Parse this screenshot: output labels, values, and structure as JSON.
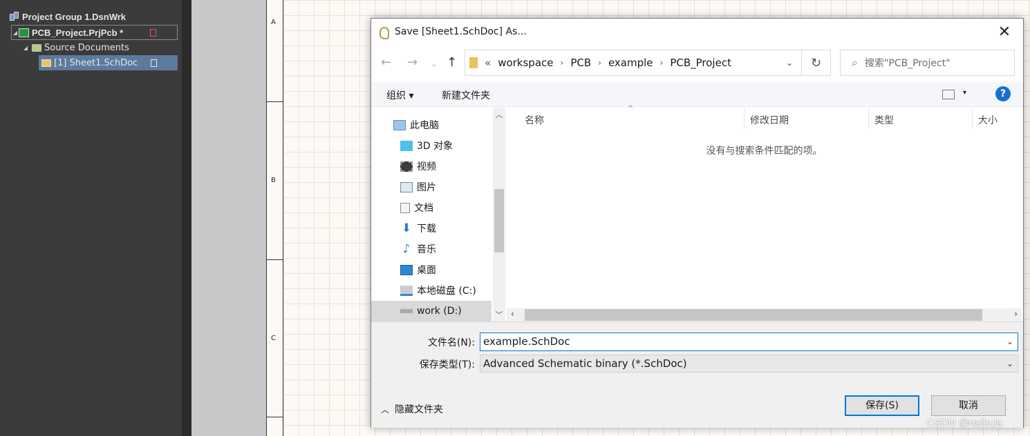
{
  "project_panel": {
    "group": "Project Group 1.DsnWrk",
    "project": "PCB_Project.PrjPcb *",
    "folder": "Source Documents",
    "sheet": "[1] Sheet1.SchDoc"
  },
  "schematic": {
    "zones": [
      "A",
      "B",
      "C"
    ]
  },
  "dialog": {
    "title": "Save [Sheet1.SchDoc] As...",
    "close": "✕",
    "address": {
      "overflow": "«",
      "crumbs": [
        "workspace",
        "PCB",
        "example",
        "PCB_Project"
      ]
    },
    "search_placeholder": "搜索\"PCB_Project\"",
    "toolbar": {
      "organize": "组织 ▾",
      "new_folder": "新建文件夹",
      "help": "?"
    },
    "nav_items": [
      {
        "label": "此电脑",
        "icon": "computer-icon"
      },
      {
        "label": "3D 对象",
        "icon": "cube-icon"
      },
      {
        "label": "视频",
        "icon": "video-icon"
      },
      {
        "label": "图片",
        "icon": "picture-icon"
      },
      {
        "label": "文档",
        "icon": "document-icon"
      },
      {
        "label": "下载",
        "icon": "download-icon"
      },
      {
        "label": "音乐",
        "icon": "music-icon"
      },
      {
        "label": "桌面",
        "icon": "desktop-icon"
      },
      {
        "label": "本地磁盘 (C:)",
        "icon": "drive-icon"
      },
      {
        "label": "work (D:)",
        "icon": "drive-icon"
      }
    ],
    "columns": [
      "名称",
      "修改日期",
      "类型",
      "大小"
    ],
    "empty_message": "没有与搜索条件匹配的项。",
    "filename_label": "文件名(N):",
    "filename_value": "example.SchDoc",
    "filetype_label": "保存类型(T):",
    "filetype_value": "Advanced Schematic binary (*.SchDoc)",
    "hide_folders": "隐藏文件夹",
    "save_button": "保存(S)",
    "cancel_button": "取消"
  },
  "watermark": "CSDN @naibula",
  "colors": {
    "accent": "#0078d7",
    "panel_bg": "#3b3b3b",
    "selected_tree": "#5c7a9c"
  }
}
